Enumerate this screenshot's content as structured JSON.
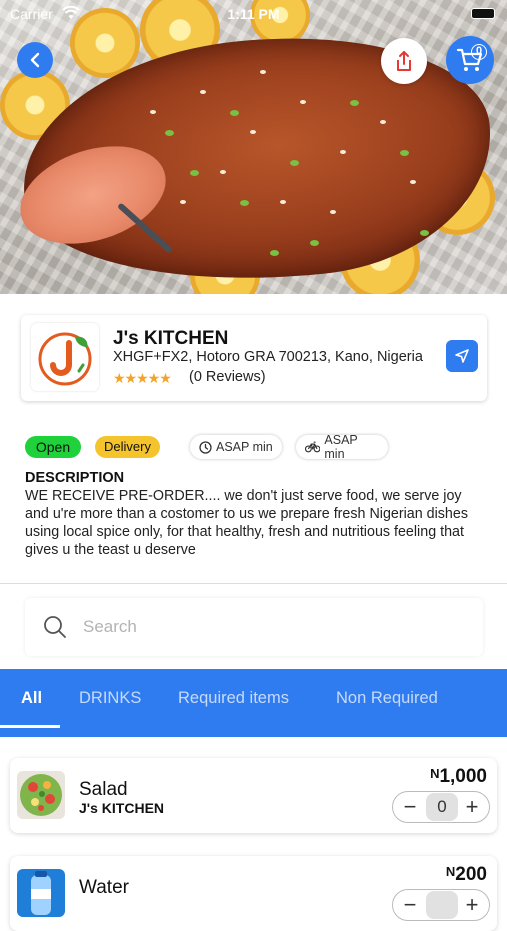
{
  "status_bar": {
    "carrier": "Carrier",
    "time": "1:11 PM"
  },
  "header": {
    "cart_count": "0"
  },
  "store": {
    "name": "J's KITCHEN",
    "address": "XHGF+FX2, Hotoro GRA 700213, Kano, Nigeria",
    "rating_stars": "★★★★★",
    "reviews": "(0 Reviews)"
  },
  "badges": {
    "open": "Open",
    "delivery": "Delivery"
  },
  "chips": {
    "time_label": "ASAP min",
    "delivery_time_label": "ASAP min"
  },
  "description": {
    "title": "DESCRIPTION",
    "text": "WE RECEIVE PRE-ORDER.... we don't just serve food, we serve joy and u're more than a costomer to us we prepare fresh Nigerian dishes using local spice only, for that healthy, fresh and nutritious feeling that gives u the teast u deserve"
  },
  "search": {
    "placeholder": "Search",
    "value": ""
  },
  "tabs": [
    {
      "label": "All",
      "active": true
    },
    {
      "label": "DRINKS",
      "active": false
    },
    {
      "label": "Required items",
      "active": false
    },
    {
      "label": "Non Required",
      "active": false
    }
  ],
  "items": [
    {
      "name": "Salad",
      "vendor": "J's KITCHEN",
      "currency": "N",
      "price": "1,000",
      "qty": "0"
    },
    {
      "name": "Water",
      "vendor": "",
      "currency": "N",
      "price": "200",
      "qty": ""
    }
  ],
  "colors": {
    "accent": "#2f7bf0",
    "open": "#1fd13a",
    "delivery": "#f5c42c",
    "stars": "#f3a32a"
  }
}
